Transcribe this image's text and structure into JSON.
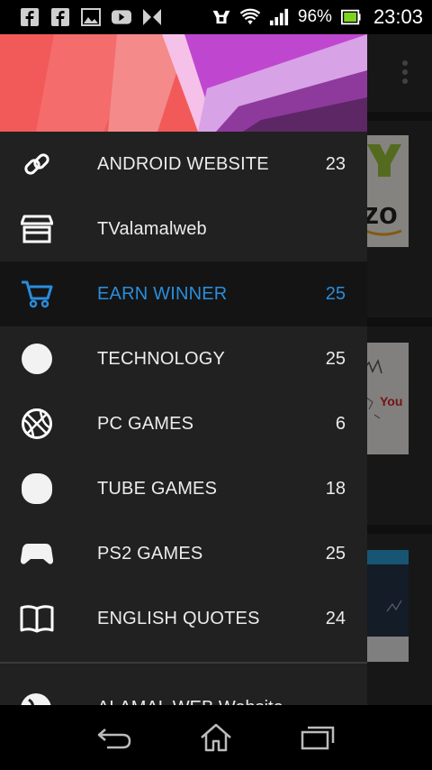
{
  "status_bar": {
    "notification_icons": [
      "facebook-icon",
      "facebook-icon",
      "image-icon",
      "youtube-icon",
      "bowtie-icon"
    ],
    "battery_percent": "96%",
    "time": "23:03"
  },
  "drawer": {
    "items": [
      {
        "label": "ANDROID WEBSITE",
        "count": "23",
        "icon": "link-icon",
        "active": false
      },
      {
        "label": "TValamalweb",
        "count": "",
        "icon": "store-icon",
        "active": false
      },
      {
        "label": "EARN WINNER",
        "count": "25",
        "icon": "cart-icon",
        "active": true
      },
      {
        "label": "TECHNOLOGY",
        "count": "25",
        "icon": "circle-icon",
        "active": false
      },
      {
        "label": "PC GAMES",
        "count": "6",
        "icon": "basketball-icon",
        "active": false
      },
      {
        "label": "TUBE GAMES",
        "count": "18",
        "icon": "blob-icon",
        "active": false
      },
      {
        "label": "PS2 GAMES",
        "count": "25",
        "icon": "gamepad-icon",
        "active": false
      },
      {
        "label": "ENGLISH QUOTES",
        "count": "24",
        "icon": "book-icon",
        "active": false
      }
    ],
    "partial_item_label": "ALAMAL WEB Website"
  },
  "colors": {
    "active": "#2a8ddc",
    "drawer_bg": "#212121"
  }
}
